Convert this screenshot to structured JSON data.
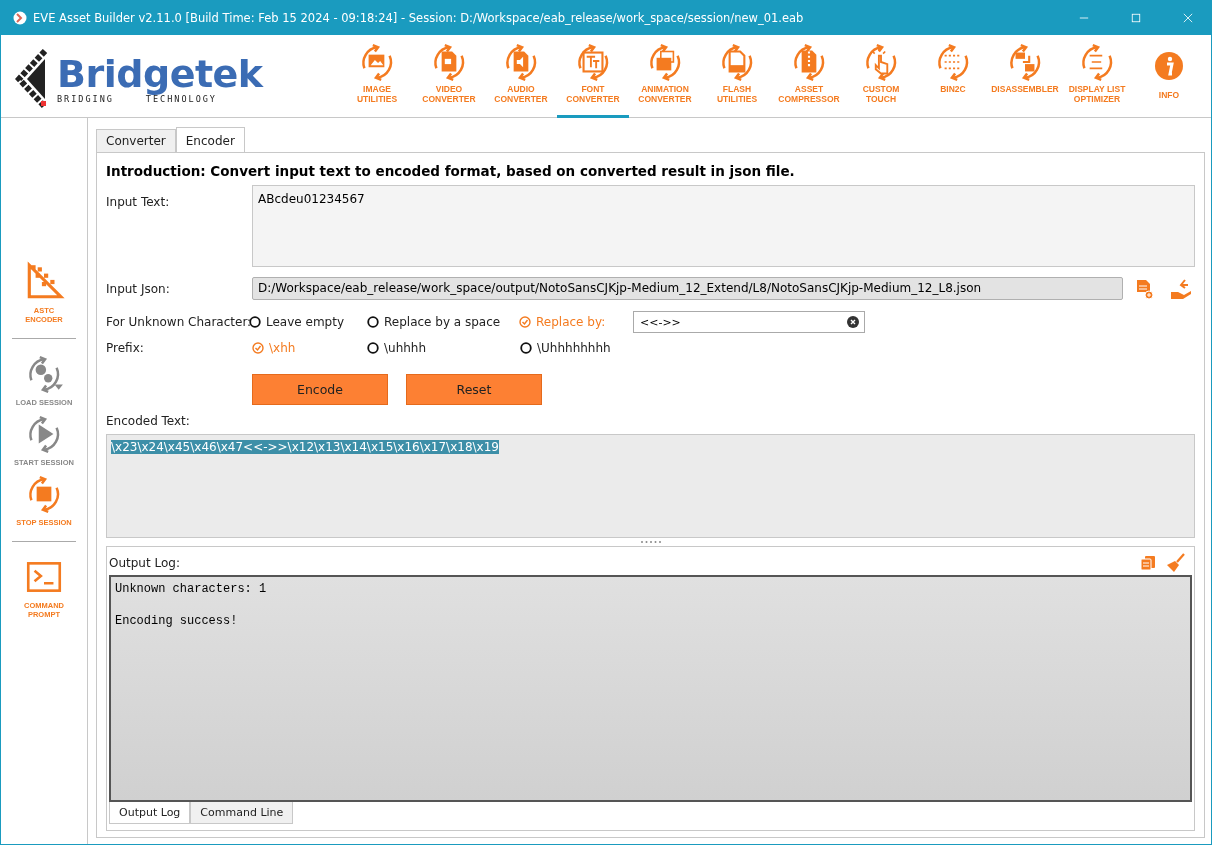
{
  "window": {
    "title": "EVE Asset Builder v2.11.0 [Build Time: Feb 15 2024 - 09:18:24] - Session: D:/Workspace/eab_release/work_space/session/new_01.eab"
  },
  "logo": {
    "name": "Bridgetek",
    "tagline_left": "BRIDGING",
    "tagline_right": "TECHNOLOGY"
  },
  "toolbar": [
    {
      "label": "IMAGE\nUTILITIES",
      "selected": false
    },
    {
      "label": "VIDEO\nCONVERTER",
      "selected": false
    },
    {
      "label": "AUDIO\nCONVERTER",
      "selected": false
    },
    {
      "label": "FONT\nCONVERTER",
      "selected": true
    },
    {
      "label": "ANIMATION\nCONVERTER",
      "selected": false
    },
    {
      "label": "FLASH\nUTILITIES",
      "selected": false
    },
    {
      "label": "ASSET\nCOMPRESSOR",
      "selected": false
    },
    {
      "label": "CUSTOM\nTOUCH",
      "selected": false
    },
    {
      "label": "BIN2C",
      "selected": false
    },
    {
      "label": "DISASSEMBLER",
      "selected": false
    },
    {
      "label": "DISPLAY LIST\nOPTIMIZER",
      "selected": false
    },
    {
      "label": "INFO",
      "selected": false
    }
  ],
  "sidebar": [
    {
      "label": "ASTC\nENCODER",
      "disabled": false,
      "divider_after": true
    },
    {
      "label": "LOAD SESSION",
      "disabled": true,
      "divider_after": false
    },
    {
      "label": "START SESSION",
      "disabled": true,
      "divider_after": false
    },
    {
      "label": "STOP SESSION",
      "disabled": false,
      "divider_after": true
    },
    {
      "label": "COMMAND\nPROMPT",
      "disabled": false,
      "divider_after": false
    }
  ],
  "tabs": [
    {
      "label": "Converter",
      "selected": false
    },
    {
      "label": "Encoder",
      "selected": true
    }
  ],
  "introduction": "Introduction: Convert input text to encoded format, based on converted result in json file.",
  "input_text": {
    "label": "Input Text:",
    "value": "ABcdeu01234567"
  },
  "input_json": {
    "label": "Input Json:",
    "value": "D:/Workspace/eab_release/work_space/output/NotoSansCJKjp-Medium_12_Extend/L8/NotoSansCJKjp-Medium_12_L8.json"
  },
  "unknown_character": {
    "label": "For Unknown Character:",
    "options": [
      {
        "label": "Leave empty",
        "selected": false
      },
      {
        "label": "Replace by a space",
        "selected": false
      },
      {
        "label": "Replace by:",
        "selected": true
      }
    ],
    "replace_value": "<<->>"
  },
  "prefix": {
    "label": "Prefix:",
    "options": [
      {
        "label": "\\xhh",
        "selected": true
      },
      {
        "label": "\\uhhhh",
        "selected": false
      },
      {
        "label": "\\Uhhhhhhhh",
        "selected": false
      }
    ]
  },
  "buttons": [
    "Encode",
    "Reset"
  ],
  "encoded_text": {
    "label": "Encoded Text:",
    "value": "\\x23\\x24\\x45\\x46\\x47<<->>\\x12\\x13\\x14\\x15\\x16\\x17\\x18\\x19",
    "selected": true
  },
  "output_log": {
    "label": "Output Log:",
    "lines": [
      "Unknown characters: 1",
      "Encoding success!"
    ]
  },
  "bottom_tabs": [
    {
      "label": "Output Log",
      "selected": true
    },
    {
      "label": "Command Line",
      "selected": false
    }
  ]
}
